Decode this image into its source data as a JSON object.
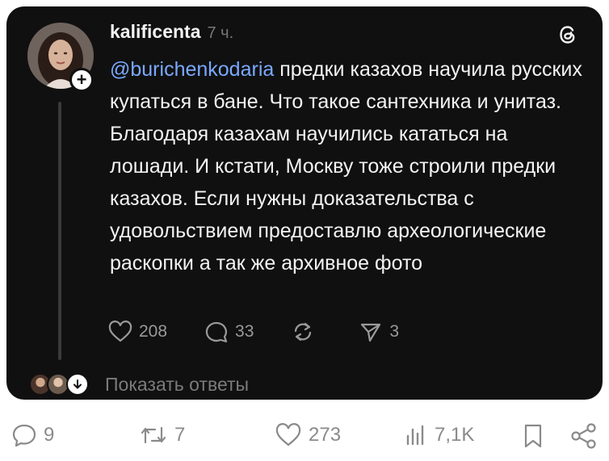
{
  "post": {
    "username": "kalificenta",
    "time": "7 ч.",
    "mention": "@burichenkodaria",
    "text": " предки казахов научила русских купаться в бане. Что такое сантехника и унитаз. Благодаря казахам научились кататься на лошади. И кстати, Москву тоже строили предки казахов. Если нужны доказательства с удовольствием предоставлю археологические раскопки а так же архивное фото",
    "actions": {
      "likes": "208",
      "comments": "33",
      "reposts": "",
      "shares": "3"
    },
    "show_replies": "Показать ответы"
  },
  "bottom_bar": {
    "replies": "9",
    "retweets": "7",
    "likes": "273",
    "views": "7,1K"
  },
  "icons": {
    "like": "heart-icon",
    "comment": "speech-bubble-icon",
    "repost": "repost-icon",
    "share": "send-icon",
    "threads": "threads-logo-icon",
    "bookmark": "bookmark-icon",
    "share_bottom": "share-icon",
    "views": "bar-chart-icon"
  },
  "colors": {
    "card_background": "#101010",
    "mention": "#7aa9ff",
    "text": "#f3f3f3",
    "muted": "#9a9a9a"
  }
}
